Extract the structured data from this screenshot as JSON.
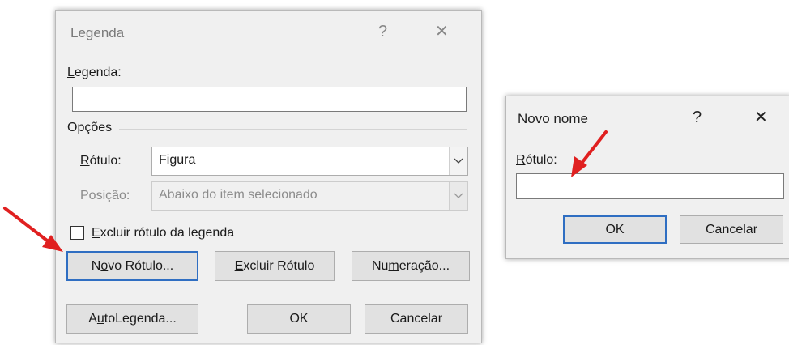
{
  "legend_dialog": {
    "title": "Legenda",
    "help_glyph": "?",
    "close_glyph": "✕",
    "caption_label_prefix": "L",
    "caption_label_rest": "egenda:",
    "caption_value": "",
    "options_group": "Opções",
    "label_field_label_prefix": "R",
    "label_field_label_rest": "ótulo:",
    "label_value": "Figura",
    "position_label": "Posição:",
    "position_value": "Abaixo do item selecionado",
    "exclude_label_prefix": "E",
    "exclude_label_rest": "xcluir rótulo da legenda",
    "exclude_checked": false,
    "new_label_button_a": "N",
    "new_label_button_b": "o",
    "new_label_button_c": "vo Rótulo...",
    "delete_label_button_a": "E",
    "delete_label_button_b": "xcluir Rótulo",
    "numbering_button_a": "Nu",
    "numbering_button_b": "m",
    "numbering_button_c": "eração...",
    "autocaption_button_a": "A",
    "autocaption_button_b": "u",
    "autocaption_button_c": "toLegenda...",
    "ok_button": "OK",
    "cancel_button": "Cancelar"
  },
  "new_name_dialog": {
    "title": "Novo nome",
    "help_glyph": "?",
    "close_glyph": "✕",
    "label_prefix": "R",
    "label_rest": "ótulo:",
    "input_value": "",
    "ok_button": "OK",
    "cancel_button": "Cancelar"
  },
  "colors": {
    "annotation_arrow": "#e02020",
    "focus_border": "#2f6ec2",
    "dialog_bg": "#f0f0f0"
  }
}
